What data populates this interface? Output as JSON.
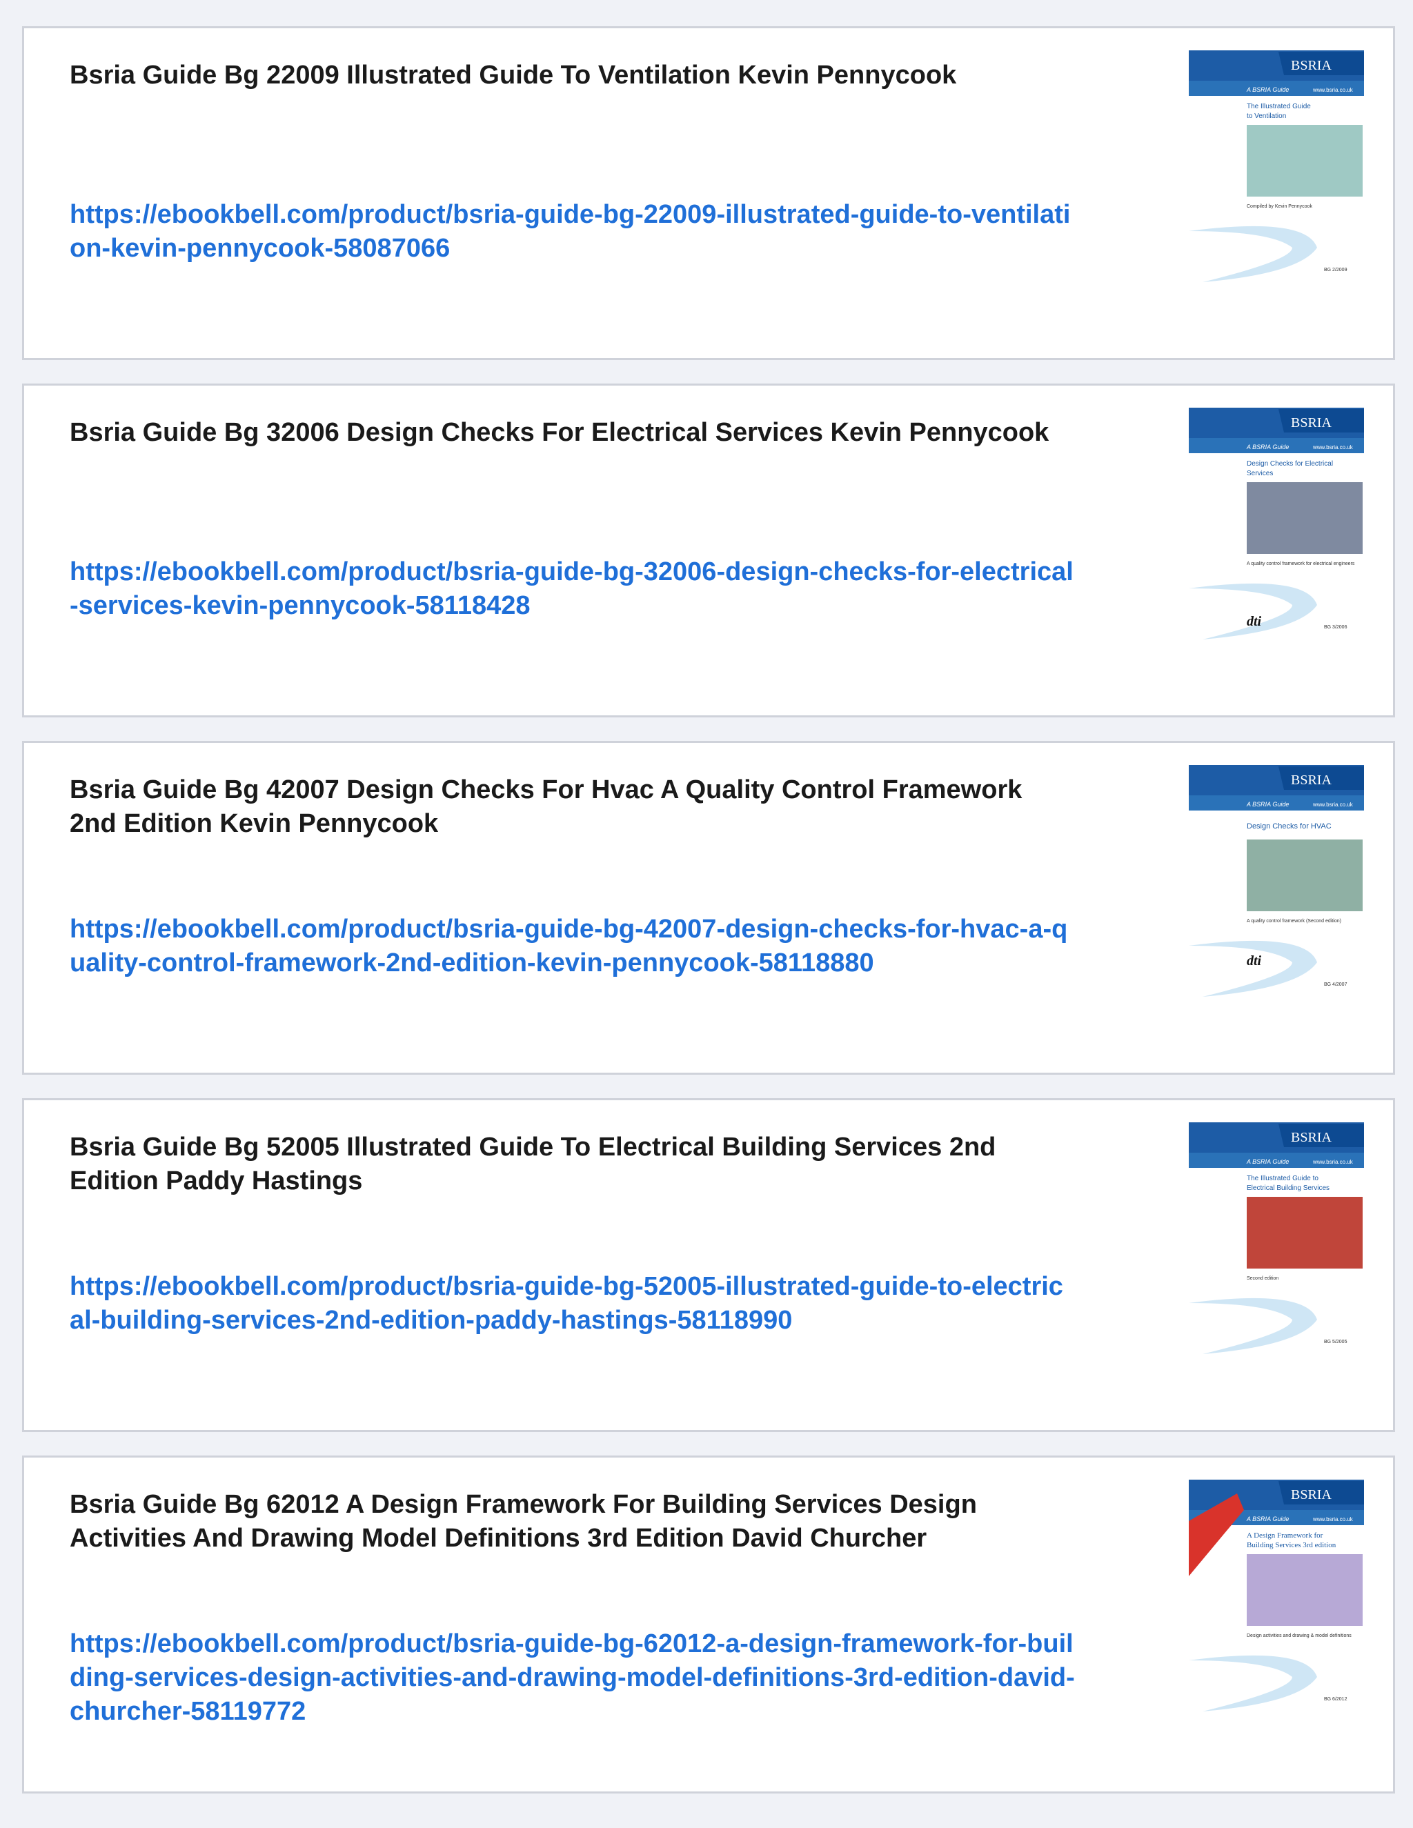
{
  "items": [
    {
      "title": "Bsria Guide Bg 22009 Illustrated Guide To Ventilation Kevin Pennycook",
      "url": "https://ebookbell.com/product/bsria-guide-bg-22009-illustrated-guide-to-ventilation-kevin-pennycook-58087066",
      "cover": {
        "brand": "BSRIA",
        "series": "A BSRIA Guide",
        "site": "www.bsria.co.uk",
        "heading1": "The Illustrated Guide",
        "heading2": "to Ventilation",
        "sub": "Compiled by Kevin Pennycook",
        "code": "BG 2/2009",
        "image_color": "#9fc9c4"
      }
    },
    {
      "title": "Bsria Guide Bg 32006 Design Checks For Electrical Services Kevin Pennycook",
      "url": "https://ebookbell.com/product/bsria-guide-bg-32006-design-checks-for-electrical-services-kevin-pennycook-58118428",
      "cover": {
        "brand": "BSRIA",
        "series": "A BSRIA Guide",
        "site": "www.bsria.co.uk",
        "heading1": "Design Checks for Electrical",
        "heading2": "Services",
        "sub": "A quality control framework for electrical engineers",
        "code": "BG 3/2006",
        "logo": "dti",
        "image_color": "#7f8aa0"
      }
    },
    {
      "title": "Bsria Guide Bg 42007 Design Checks For Hvac A Quality Control Framework 2nd Edition Kevin Pennycook",
      "url": "https://ebookbell.com/product/bsria-guide-bg-42007-design-checks-for-hvac-a-quality-control-framework-2nd-edition-kevin-pennycook-58118880",
      "cover": {
        "brand": "BSRIA",
        "series": "A BSRIA Guide",
        "site": "www.bsria.co.uk",
        "heading1": "Design Checks for HVAC",
        "heading2": "",
        "sub": "A quality control framework (Second edition)",
        "code": "BG 4/2007",
        "logo": "dti",
        "image_color": "#8fb0a4"
      }
    },
    {
      "title": "Bsria Guide Bg 52005 Illustrated Guide To Electrical Building Services 2nd Edition Paddy Hastings",
      "url": "https://ebookbell.com/product/bsria-guide-bg-52005-illustrated-guide-to-electrical-building-services-2nd-edition-paddy-hastings-58118990",
      "cover": {
        "brand": "BSRIA",
        "series": "A BSRIA Guide",
        "site": "www.bsria.co.uk",
        "heading1": "The Illustrated Guide to",
        "heading2": "Electrical Building Services",
        "sub": "Second edition",
        "code": "BG 5/2005",
        "image_color": "#c0453a"
      }
    },
    {
      "title": "Bsria Guide Bg 62012 A Design Framework For Building Services Design Activities And Drawing Model Definitions 3rd Edition David Churcher",
      "url": "https://ebookbell.com/product/bsria-guide-bg-62012-a-design-framework-for-building-services-design-activities-and-drawing-model-definitions-3rd-edition-david-churcher-58119772",
      "cover": {
        "brand": "BSRIA",
        "series": "A BSRIA Guide",
        "site": "www.bsria.co.uk",
        "heading1": "A Design Framework for",
        "heading2": "Building Services  3rd edition",
        "sub": "Design activities and drawing & model definitions",
        "code": "BG 6/2012",
        "image_color": "#b7a9d6"
      }
    }
  ]
}
